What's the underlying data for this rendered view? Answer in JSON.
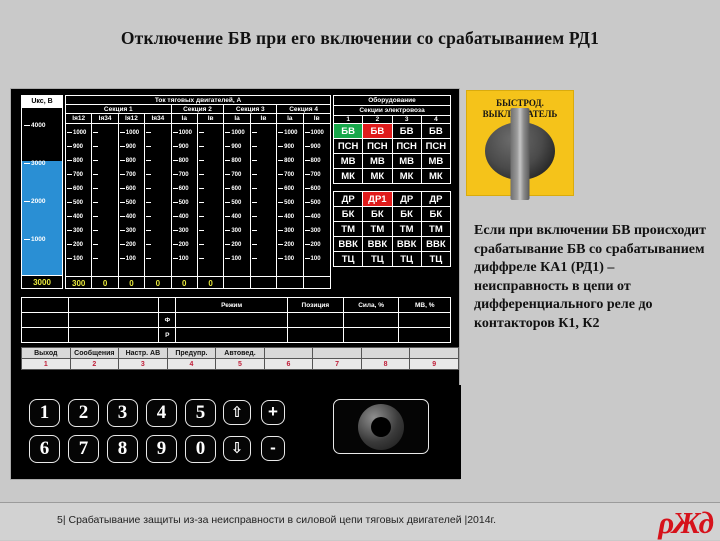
{
  "slide": {
    "title": "Отключение БВ при его включении со срабатыванием РД1"
  },
  "gauge": {
    "title": "Uкс, В",
    "ticks": [
      "4000",
      "3000",
      "2000",
      "1000"
    ],
    "value": "3000",
    "fill_color": "#2a8fd4",
    "value_color": "#e8e83c",
    "max": 4400,
    "current": 3000
  },
  "currents": {
    "header": "Ток тяговых двигателей, А",
    "sections": [
      "Секция 1",
      "Секция 2",
      "Секция 3",
      "Секция 4"
    ],
    "columns": [
      "Iя12",
      "Iя34",
      "Iя12",
      "Iя34",
      "Iа",
      "Iв",
      "Iа",
      "Iв",
      "Iа",
      "Iв"
    ],
    "scale_ticks": [
      "1000",
      "900",
      "800",
      "700",
      "600",
      "500",
      "400",
      "300",
      "200",
      "100"
    ],
    "values": [
      "300",
      "0",
      "0",
      "0",
      "0",
      "0",
      "",
      "",
      "",
      ""
    ],
    "value_color": "#e8e83c"
  },
  "equipment": {
    "title": "Оборудование",
    "subtitle": "Секции электровоза",
    "column_numbers": [
      "1",
      "2",
      "3",
      "4"
    ],
    "block1": [
      {
        "label": "БВ",
        "cells": [
          "БВ",
          "БВ",
          "БВ",
          "БВ"
        ],
        "states": [
          "green-filled",
          "red-filled",
          "white",
          "white"
        ]
      },
      {
        "label": "ПСН",
        "cells": [
          "ПСН",
          "ПСН",
          "ПСН",
          "ПСН"
        ],
        "states": [
          "green",
          "green",
          "white",
          "white"
        ]
      },
      {
        "label": "МВ",
        "cells": [
          "МВ",
          "МВ",
          "МВ",
          "МВ"
        ],
        "states": [
          "green",
          "green",
          "white",
          "white"
        ]
      },
      {
        "label": "МК",
        "cells": [
          "МК",
          "МК",
          "МК",
          "МК"
        ],
        "states": [
          "green",
          "green",
          "white",
          "white"
        ]
      }
    ],
    "block2": [
      {
        "label": "ДР",
        "cells": [
          "ДР",
          "ДР1",
          "ДР",
          "ДР"
        ],
        "states": [
          "green",
          "red-filled",
          "white",
          "white"
        ]
      },
      {
        "label": "БК",
        "cells": [
          "БК",
          "БК",
          "БК",
          "БК"
        ],
        "states": [
          "green",
          "green",
          "white",
          "white"
        ]
      },
      {
        "label": "ТМ",
        "cells": [
          "ТМ",
          "ТМ",
          "ТМ",
          "ТМ"
        ],
        "states": [
          "green",
          "green",
          "white",
          "white"
        ]
      },
      {
        "label": "ВВК",
        "cells": [
          "ВВК",
          "ВВК",
          "ВВК",
          "ВВК"
        ],
        "states": [
          "green",
          "green",
          "white",
          "white"
        ]
      },
      {
        "label": "ТЦ",
        "cells": [
          "ТЦ",
          "ТЦ",
          "ТЦ",
          "ТЦ"
        ],
        "states": [
          "green",
          "green",
          "white",
          "white"
        ]
      }
    ],
    "colors": {
      "green_text": "#18c464",
      "green_fill": "#17a74a",
      "red_fill": "#e01b1b",
      "white_text": "#ffffff"
    }
  },
  "mid_table": {
    "headers": [
      "",
      "",
      "",
      "Режим",
      "Позиция",
      "Сила, %",
      "МВ, %",
      ""
    ],
    "row_labels": [
      "Ф",
      "Р"
    ]
  },
  "function_bar": {
    "labels": [
      "Выход",
      "Сообщения",
      "Настр. АВ",
      "Предупр.",
      "Автовед.",
      "",
      "",
      "",
      ""
    ],
    "indices": [
      "1",
      "2",
      "3",
      "4",
      "5",
      "6",
      "7",
      "8",
      "9"
    ],
    "index_color": "#c0203a"
  },
  "keypad": {
    "row1": [
      "1",
      "2",
      "3",
      "4",
      "5"
    ],
    "row2": [
      "6",
      "7",
      "8",
      "9",
      "0"
    ],
    "arrow_up": "⇧",
    "arrow_down": "⇩",
    "plus": "+",
    "minus": "-"
  },
  "switch_panel": {
    "label_line1": "БЫСТРОД.",
    "label_line2": "ВЫКЛЮЧАТЕЛЬ",
    "background": "#f5c31a"
  },
  "note": {
    "text": "Если при включении БВ происходит срабатывание БВ со срабатыванием диффреле КА1 (РД1) – неисправность в цепи от дифференциального реле до контакторов К1, К2"
  },
  "footer": {
    "text": "5|  Срабатывание защиты из-за неисправности в силовой цепи тяговых двигателей  |2014г.",
    "logo": "ρЖд"
  }
}
